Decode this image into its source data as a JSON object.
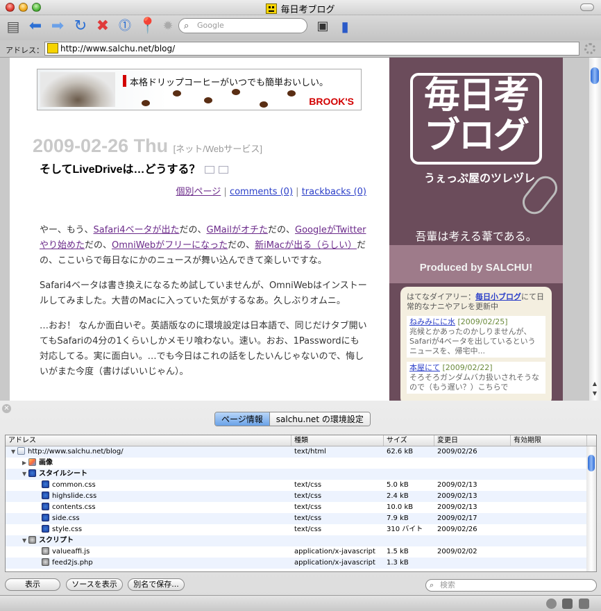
{
  "window": {
    "title": "毎日考ブログ"
  },
  "toolbar": {
    "search_placeholder": "Google"
  },
  "address": {
    "label": "アドレス：",
    "url": "http://www.salchu.net/blog/"
  },
  "ad": {
    "copy": "本格ドリップコーヒーがいつでも簡単おいしい。",
    "brand": "BROOK'S"
  },
  "post": {
    "date": "2009-02-26 Thu",
    "category": "[ネット/Webサービス]",
    "title": "そしてLiveDriveは…どうする？",
    "meta": {
      "permalink": "個別ページ",
      "comments": "comments (0)",
      "trackbacks": "trackbacks (0)"
    },
    "p1": {
      "t0": "やー、もう、",
      "l1": "Safari4ベータが出た",
      "t1": "だの、",
      "l2": "GMailがオチた",
      "t2": "だの、",
      "l3": "GoogleがTwitterやり始めた",
      "t3": "だの、",
      "l4": "OmniWebがフリーになった",
      "t4": "だの、",
      "l5": "新iMacが出る（らしい）",
      "t5": "だの、ここいらで毎日なにかのニュースが舞い込んできて楽しいですな。"
    },
    "p2": "Safari4ベータは書き換えになるため試していませんが、OmniWebはインストールしてみました。大昔のMacに入っていた気がするなあ。久しぶりオムニ。",
    "p3": "…おお！ なんか面白いぞ。英語版なのに環境設定は日本語で、同じだけタブ開いてもSafariの4分の1くらいしかメモリ喰わない。速い。おお、1Passwordにも対応してる。実に面白い。…でも今日はこれの話をしたいんじゃないので、悔しいがまた今度（書けばいいじゃん）。"
  },
  "sidebar": {
    "logo_line1": "毎日考",
    "logo_line2": "ブログ",
    "tagline": "うぇっぷ屋のツレヅレ",
    "motto": "吾輩は考える葦である。",
    "produced": "Produced by SALCHU!",
    "diary_prefix": "はてなダイアリー：",
    "diary_link": "毎日小ブログ",
    "diary_suffix": "にて日常的なナニやアレを更新中",
    "entries": [
      {
        "title": "ねみみにに水",
        "date": "[2009/02/25]",
        "text": "兆候とかあったのかしりませんが、Safariが4ベータを出しているというニュースを、帰宅中..."
      },
      {
        "title": "本屋にて",
        "date": "[2009/02/22]",
        "text": "そろそろガンダムバカ扱いされそうなので（もう遅い？）こちらで"
      }
    ]
  },
  "inspector": {
    "tabs": [
      "ページ情報",
      "salchu.net の環境設定"
    ],
    "columns": [
      "アドレス",
      "種類",
      "サイズ",
      "変更日",
      "有効期限"
    ],
    "rows": [
      {
        "name": "http://www.salchu.net/blog/",
        "type": "text/html",
        "size": "62.6 kB",
        "date": "2009/02/26",
        "expires": ""
      },
      {
        "name": "画像",
        "type": "",
        "size": "",
        "date": "",
        "expires": ""
      },
      {
        "name": "スタイルシート",
        "type": "",
        "size": "",
        "date": "",
        "expires": ""
      },
      {
        "name": "common.css",
        "type": "text/css",
        "size": "5.0 kB",
        "date": "2009/02/13",
        "expires": ""
      },
      {
        "name": "highslide.css",
        "type": "text/css",
        "size": "2.4 kB",
        "date": "2009/02/13",
        "expires": ""
      },
      {
        "name": "contents.css",
        "type": "text/css",
        "size": "10.0 kB",
        "date": "2009/02/13",
        "expires": ""
      },
      {
        "name": "side.css",
        "type": "text/css",
        "size": "7.9 kB",
        "date": "2009/02/17",
        "expires": ""
      },
      {
        "name": "style.css",
        "type": "text/css",
        "size": "310 バイト",
        "date": "2009/02/26",
        "expires": ""
      },
      {
        "name": "スクリプト",
        "type": "",
        "size": "",
        "date": "",
        "expires": ""
      },
      {
        "name": "valueaffi.js",
        "type": "application/x-javascript",
        "size": "1.5 kB",
        "date": "2009/02/02",
        "expires": ""
      },
      {
        "name": "feed2js.php",
        "type": "application/x-javascript",
        "size": "1.3 kB",
        "date": "",
        "expires": ""
      }
    ],
    "buttons": {
      "show": "表示",
      "source": "ソースを表示",
      "save": "別名で保存..."
    },
    "search_placeholder": "検索"
  }
}
